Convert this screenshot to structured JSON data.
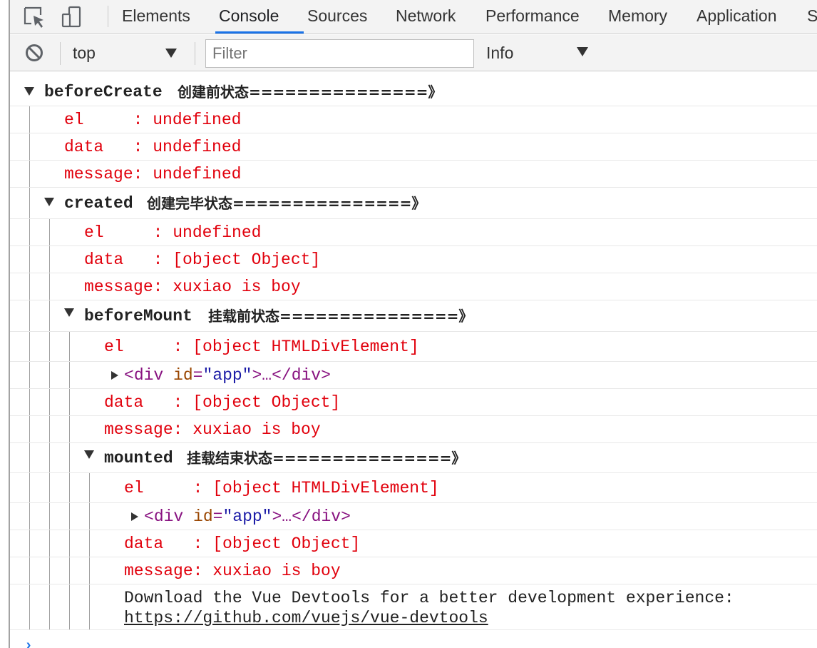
{
  "tabs": [
    {
      "label": "Elements"
    },
    {
      "label": "Console"
    },
    {
      "label": "Sources"
    },
    {
      "label": "Network"
    },
    {
      "label": "Performance"
    },
    {
      "label": "Memory"
    },
    {
      "label": "Application"
    },
    {
      "label": "S"
    }
  ],
  "active_tab": "Console",
  "icons": {
    "inspect": "inspect-element-icon",
    "device": "device-toolbar-icon",
    "clear": "clear-console-icon",
    "dropdown": "chevron-down-icon",
    "group": "triangle-down-icon",
    "expand": "triangle-right-icon",
    "prompt": "prompt-icon"
  },
  "toolbar": {
    "context": "top",
    "filter_placeholder": "Filter",
    "level": "Info"
  },
  "log": {
    "before_create": {
      "name": "beforeCreate",
      "label": "创建前状态===============》",
      "el": "el     : undefined",
      "data": "data   : undefined",
      "message": "message: undefined"
    },
    "created": {
      "name": "created",
      "label": "创建完毕状态===============》",
      "el": "el     : undefined",
      "data": "data   : [object Object]",
      "message": "message: xuxiao is boy"
    },
    "before_mount": {
      "name": "beforeMount",
      "label": "挂载前状态===============》",
      "el": "el     : [object HTMLDivElement]",
      "node": {
        "open": "<",
        "tag": "div",
        "attr": "id",
        "eq": "=",
        "value": "\"app\"",
        "rest": ">…</",
        "close": ">"
      },
      "data": "data   : [object Object]",
      "message": "message: xuxiao is boy"
    },
    "mounted": {
      "name": "mounted",
      "label": "挂载结束状态===============》",
      "el": "el     : [object HTMLDivElement]",
      "node": {
        "open": "<",
        "tag": "div",
        "attr": "id",
        "eq": "=",
        "value": "\"app\"",
        "rest": ">…</",
        "close": ">"
      },
      "data": "data   : [object Object]",
      "message": "message: xuxiao is boy"
    },
    "devtools_tip": "Download the Vue Devtools for a better development experience:",
    "devtools_link": "https://github.com/vuejs/vue-devtools",
    "prompt": "›"
  },
  "colors": {
    "error_text": "#e1000c",
    "active_tab_underline": "#1a73e8",
    "toolbar_bg": "#f3f3f3",
    "tag_purple": "#881280",
    "attr_brown": "#994500",
    "value_blue": "#1a1aa6"
  }
}
